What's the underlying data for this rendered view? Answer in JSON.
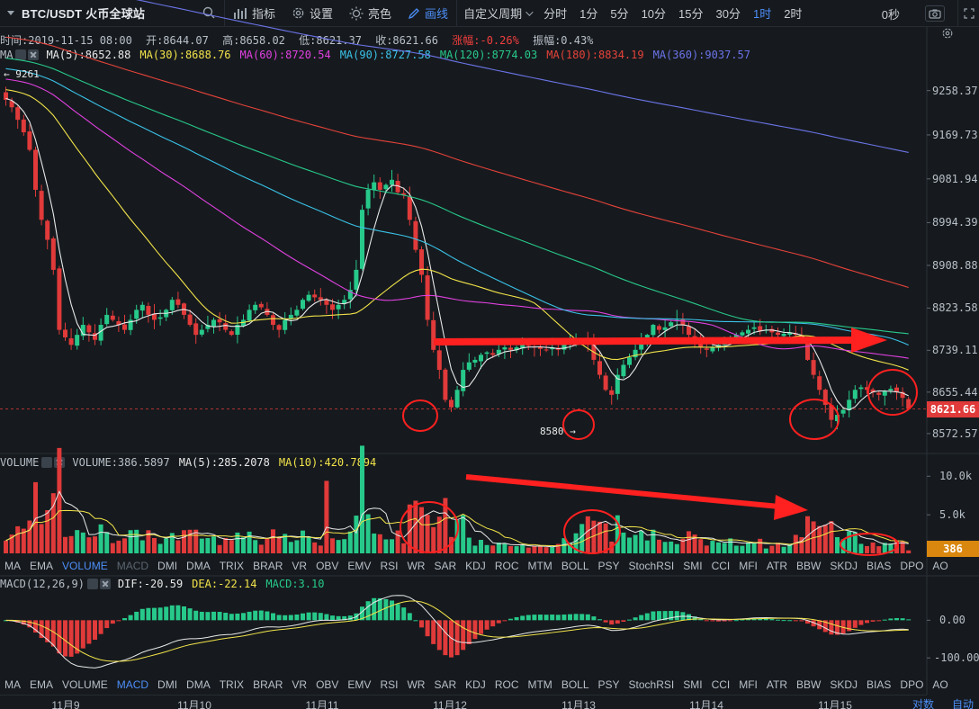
{
  "toolbar": {
    "symbol": "BTC/USDT 火币全球站",
    "indicators_label": "指标",
    "settings_label": "设置",
    "theme_label": "亮色",
    "draw_label": "画线",
    "custom_period_label": "自定义周期",
    "periods": [
      "分时",
      "1分",
      "5分",
      "10分",
      "15分",
      "30分",
      "1时",
      "2时"
    ],
    "active_period": "1时",
    "countdown": "0秒"
  },
  "info": {
    "time": "时间:2019-11-15 08:00",
    "open": "开:8644.07",
    "high": "高:8658.02",
    "low": "低:8621.37",
    "close": "收:8621.66",
    "change": "涨幅:-0.26%",
    "amplitude": "振幅:0.43%"
  },
  "ma_legend": {
    "title": "MA",
    "items": [
      {
        "label": "MA(5):8652.88",
        "color": "#e8e8e8"
      },
      {
        "label": "MA(30):8688.76",
        "color": "#f2e34a"
      },
      {
        "label": "MA(60):8720.54",
        "color": "#e040e0"
      },
      {
        "label": "MA(90):8727.58",
        "color": "#3ac2e8"
      },
      {
        "label": "MA(120):8774.03",
        "color": "#27c98a"
      },
      {
        "label": "MA(180):8834.19",
        "color": "#e5423a"
      },
      {
        "label": "MA(360):9037.57",
        "color": "#6b74e8"
      }
    ]
  },
  "volume_legend": {
    "title": "VOLUME",
    "items": [
      {
        "label": "VOLUME:386.5897",
        "color": "#b8bfc8"
      },
      {
        "label": "MA(5):285.2078",
        "color": "#e8e8e8"
      },
      {
        "label": "MA(10):420.7894",
        "color": "#f2e34a"
      }
    ]
  },
  "macd_legend": {
    "title": "MACD(12,26,9)",
    "items": [
      {
        "label": "DIF:-20.59",
        "color": "#e8e8e8"
      },
      {
        "label": "DEA:-22.14",
        "color": "#f2e34a"
      },
      {
        "label": "MACD:3.10",
        "color": "#27c98a"
      }
    ]
  },
  "indicator_tabs": [
    "MA",
    "EMA",
    "VOLUME",
    "MACD",
    "DMI",
    "DMA",
    "TRIX",
    "BRAR",
    "VR",
    "OBV",
    "EMV",
    "RSI",
    "WR",
    "SAR",
    "KDJ",
    "ROC",
    "MTM",
    "BOLL",
    "PSY",
    "StochRSI",
    "SMI",
    "CCI",
    "MFI",
    "ATR",
    "BBW",
    "SKDJ",
    "BIAS",
    "DPO",
    "AO"
  ],
  "tabs_row1_active": "VOLUME",
  "tabs_row1_dim": "MACD",
  "tabs_row2_active": "MACD",
  "dates": [
    "11月9",
    "11月10",
    "11月11",
    "11月12",
    "11月13",
    "11月14",
    "11月15"
  ],
  "axis_buttons": [
    "对数",
    "自动"
  ],
  "price_axis": [
    "9258.37",
    "9169.73",
    "9081.94",
    "8994.39",
    "8908.88",
    "8823.58",
    "8739.11",
    "8655.44",
    "8572.57"
  ],
  "current_price": "8621.66",
  "volume_axis": [
    "10.0k",
    "5.0k"
  ],
  "current_volume": "386",
  "macd_axis": [
    "0.00",
    "-100.00"
  ],
  "annotations": {
    "high_mark": "9261",
    "low_mark": "8580"
  },
  "chart_data": {
    "type": "candlestick",
    "interval": "1h",
    "x_range": [
      "2019-11-08 20:00",
      "2019-11-15 08:00"
    ],
    "price_ylim": [
      8540,
      9310
    ],
    "closes": [
      9240,
      9225,
      9200,
      9175,
      9140,
      9060,
      9000,
      8960,
      8900,
      8780,
      8765,
      8750,
      8770,
      8790,
      8775,
      8760,
      8790,
      8810,
      8800,
      8790,
      8780,
      8800,
      8820,
      8830,
      8810,
      8800,
      8805,
      8820,
      8840,
      8830,
      8810,
      8790,
      8770,
      8780,
      8790,
      8800,
      8795,
      8780,
      8770,
      8790,
      8800,
      8820,
      8830,
      8825,
      8810,
      8790,
      8780,
      8800,
      8810,
      8820,
      8840,
      8850,
      8845,
      8840,
      8830,
      8820,
      8830,
      8840,
      8860,
      8900,
      9020,
      9060,
      9075,
      9060,
      9070,
      9080,
      9055,
      9050,
      9000,
      8940,
      8890,
      8800,
      8740,
      8700,
      8640,
      8625,
      8660,
      8700,
      8715,
      8720,
      8730,
      8735,
      8730,
      8740,
      8745,
      8740,
      8745,
      8750,
      8748,
      8745,
      8742,
      8740,
      8745,
      8740,
      8750,
      8755,
      8760,
      8758,
      8755,
      8720,
      8690,
      8660,
      8650,
      8690,
      8710,
      8725,
      8740,
      8760,
      8770,
      8790,
      8780,
      8785,
      8795,
      8800,
      8790,
      8770,
      8755,
      8745,
      8740,
      8745,
      8750,
      8755,
      8765,
      8770,
      8775,
      8780,
      8785,
      8778,
      8780,
      8775,
      8770,
      8772,
      8775,
      8770,
      8760,
      8720,
      8690,
      8660,
      8630,
      8600,
      8610,
      8620,
      8640,
      8660,
      8665,
      8660,
      8655,
      8650,
      8658,
      8662,
      8655,
      8644,
      8622
    ],
    "volume_ylim": [
      0,
      10500
    ],
    "macd_ylim": [
      -140,
      70
    ]
  }
}
